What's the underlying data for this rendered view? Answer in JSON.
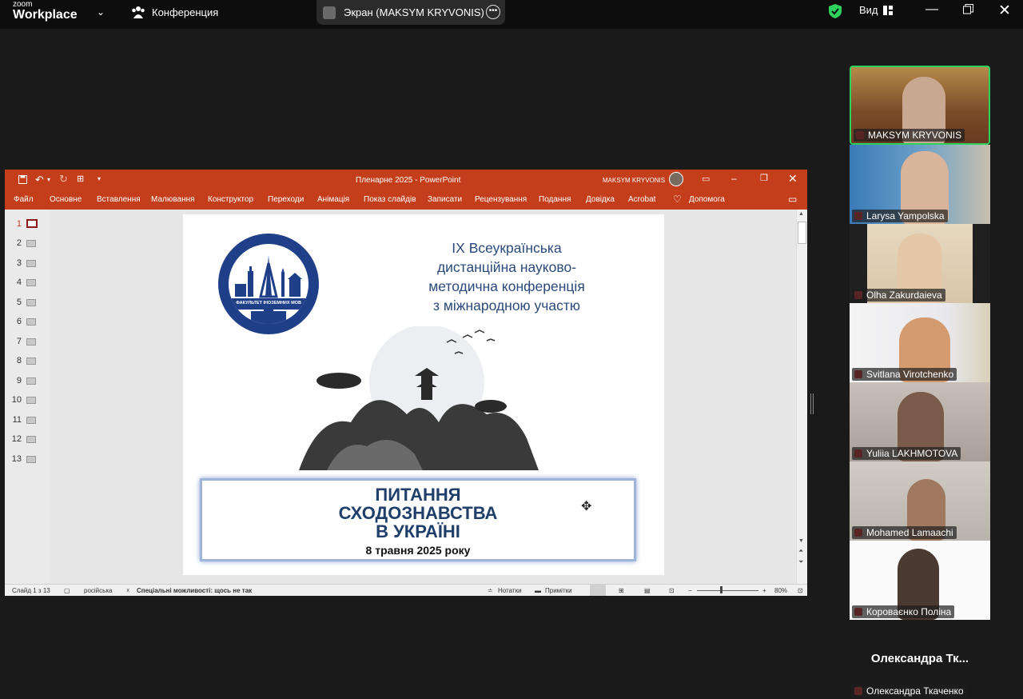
{
  "zoom": {
    "logo_line1": "zoom",
    "logo_line2": "Workplace",
    "meeting_label": "Конференция",
    "share_label": "Экран (MAKSYM KRYVONIS)",
    "view_label": "Вид",
    "accent_green": "#2dd25c",
    "bar_color": "#0d0d0d"
  },
  "powerpoint": {
    "document_title": "Пленарне 2025  -  PowerPoint",
    "user_name": "MAKSYM KRYVONIS",
    "accent": "#c43e1c",
    "menu": [
      "Файл",
      "Основне",
      "Вставлення",
      "Малювання",
      "Конструктор",
      "Переходи",
      "Анімація",
      "Показ слайдів",
      "Записати",
      "Рецензування",
      "Подання",
      "Довідка",
      "Acrobat",
      "Допомога"
    ],
    "slide_numbers": [
      "1",
      "2",
      "3",
      "4",
      "5",
      "6",
      "7",
      "8",
      "9",
      "10",
      "11",
      "12",
      "13"
    ],
    "active_slide": 1,
    "status": {
      "slide_counter": "Слайд 1 з 13",
      "language": "російська",
      "accessibility": "Спеціальні можливості: щось не так",
      "notes": "Нотатки",
      "comments": "Примітки",
      "zoom": "80%",
      "zoom_minus": "−",
      "zoom_plus": "+"
    }
  },
  "slide": {
    "logo_text": "ФАКУЛЬТЕТ ІНОЗЕМНИХ МОВ",
    "conf_lines": [
      "ІХ Всеукраїнська",
      "дистанційна науково-",
      "методична конференція",
      "з міжнародною участю"
    ],
    "title_lines": [
      "ПИТАННЯ",
      "СХОДОЗНАВСТВА",
      "В УКРАЇНІ"
    ],
    "date": "8 травня 2025 року"
  },
  "participants": [
    {
      "name": "MAKSYM KRYVONIS",
      "speaking": true
    },
    {
      "name": "Larysa Yampolska",
      "speaking": false
    },
    {
      "name": "Olha Zakurdaieva",
      "speaking": false
    },
    {
      "name": "Svitlana Virotchenko",
      "speaking": false
    },
    {
      "name": "Yuliia LAKHMOTOVA",
      "speaking": false
    },
    {
      "name": "Mohamed Lamaachi",
      "speaking": false
    },
    {
      "name": "Коровaєнко Поліна",
      "speaking": false
    },
    {
      "name": "Олександра Ткаченко",
      "speaking": false
    }
  ],
  "camera_off_tile": {
    "display_name": "Олександра  Тк..."
  }
}
